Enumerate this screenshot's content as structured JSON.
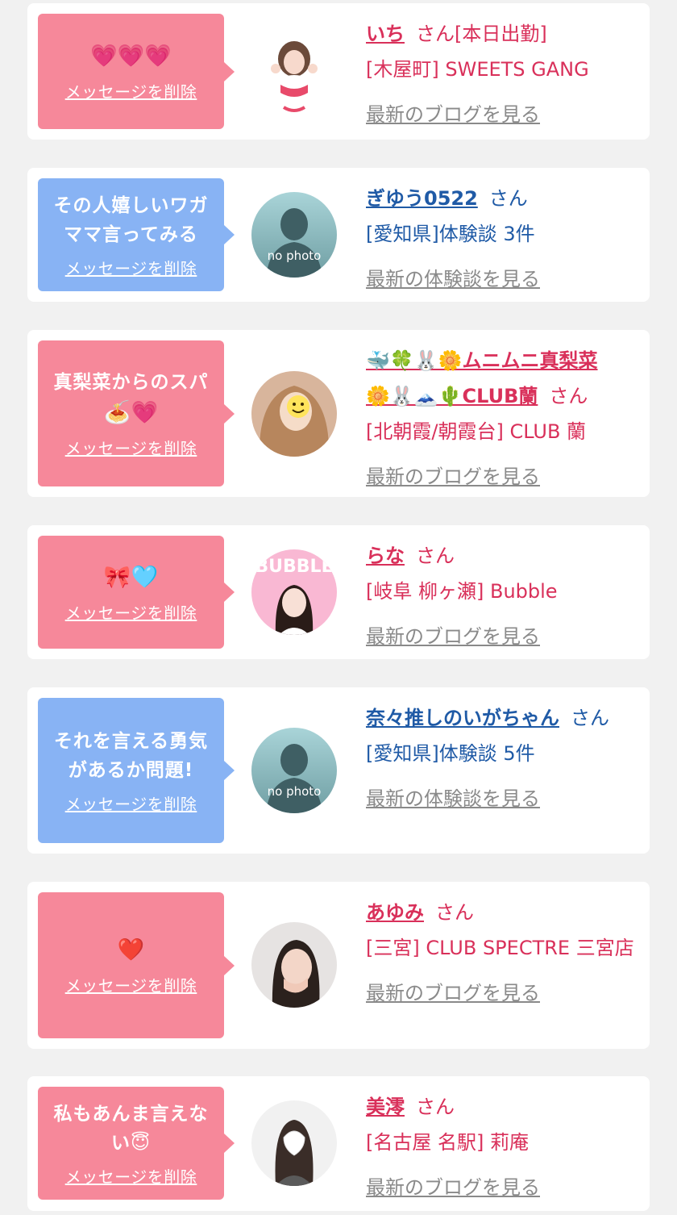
{
  "delete_label": "メッセージを削除",
  "san_suffix": "さん",
  "latest_blog_label": "最新のブログを見る",
  "latest_review_label": "最新の体験談を見る",
  "no_photo_text": "no photo",
  "colors": {
    "pink_bubble": "#f6889a",
    "blue_bubble": "#88b3f4",
    "pink_text": "#d9305a",
    "blue_text": "#1f5aa6",
    "link_gray": "#8a8a8a",
    "background": "#f1f1f1"
  },
  "items": [
    {
      "message": "💗💗💗",
      "name": "いち",
      "suffix_extra": "[本日出勤]",
      "shop": "[木屋町] SWEETS GANG"
    },
    {
      "message": "その人嬉しいワガママ言ってみる",
      "name": "ぎゆう0522",
      "shop": "[愛知県]体験談 3件"
    },
    {
      "message_line1": "真梨菜からのスパ",
      "message_line2": "🍝💗",
      "name_line1": "🐳🍀🐰🌼ムニムニ真梨菜",
      "name_line2": "🌼🐰🗻🌵CLUB蘭",
      "shop": "[北朝霞/朝霞台] CLUB 蘭"
    },
    {
      "message": "🎀🩵",
      "name": "らな",
      "shop": "[岐阜 柳ヶ瀬] Bubble",
      "avatar_text": "BUBBLE"
    },
    {
      "message": "それを言える勇気があるか問題!",
      "name": "奈々推しのいがちゃん",
      "shop": "[愛知県]体験談 5件"
    },
    {
      "message": "❤️",
      "name": "あゆみ",
      "shop": "[三宮] CLUB SPECTRE 三宮店"
    },
    {
      "message": "私もあんま言えない😇",
      "name": "美澪",
      "shop": "[名古屋 名駅] 莉庵"
    }
  ]
}
